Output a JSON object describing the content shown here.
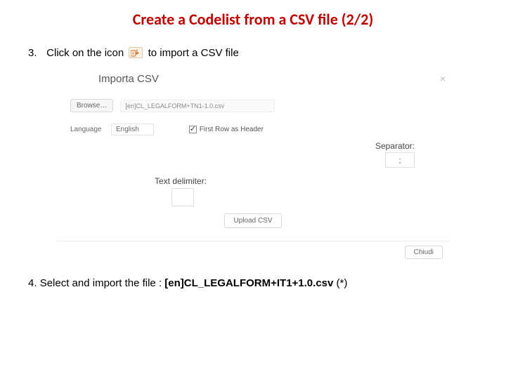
{
  "title": "Create a Codelist from a CSV file (2/2)",
  "step3": {
    "num": "3.",
    "before": "Click on the icon",
    "after": "to import a CSV file"
  },
  "dialog": {
    "title": "Importa CSV",
    "browse": "Browse…",
    "filename": "[en]CL_LEGALFORM+TN1-1.0.csv",
    "language_label": "Language",
    "language_value": "English",
    "first_row_label": "First Row as Header",
    "separator_label": "Separator:",
    "separator_value": ";",
    "text_delim_label": "Text delimiter:",
    "upload": "Upload CSV",
    "close": "Chiudi"
  },
  "step4": {
    "num": "4.",
    "text": "Select and import the file : ",
    "filename": "[en]CL_LEGALFORM+IT1+1.0.csv",
    "suffix": " (*)"
  }
}
